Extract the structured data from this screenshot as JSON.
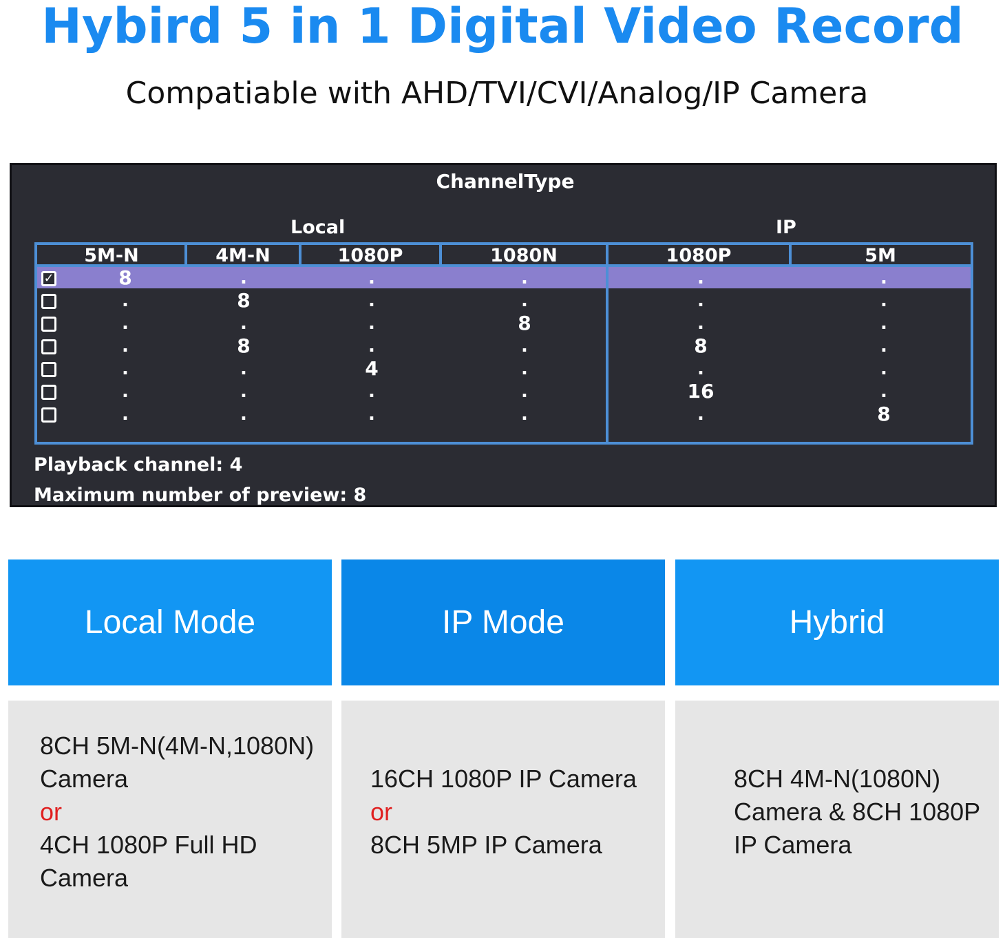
{
  "header": {
    "title": "Hybird 5 in 1 Digital Video Record",
    "subtitle": "Compatiable with AHD/TVI/CVI/Analog/IP Camera"
  },
  "dvr": {
    "window_title": "ChannelType",
    "group_local": "Local",
    "group_ip": "IP",
    "columns": [
      "5M-N",
      "4M-N",
      "1080P",
      "1080N",
      "1080P",
      "5M"
    ],
    "rows": [
      {
        "checked": true,
        "check_mark": "✓",
        "cells": [
          "8",
          ".",
          ".",
          ".",
          ".",
          "."
        ]
      },
      {
        "checked": false,
        "check_mark": "",
        "cells": [
          ".",
          "8",
          ".",
          ".",
          ".",
          "."
        ]
      },
      {
        "checked": false,
        "check_mark": "",
        "cells": [
          ".",
          ".",
          ".",
          "8",
          ".",
          "."
        ]
      },
      {
        "checked": false,
        "check_mark": "",
        "cells": [
          ".",
          "8",
          ".",
          ".",
          "8",
          "."
        ]
      },
      {
        "checked": false,
        "check_mark": "",
        "cells": [
          ".",
          ".",
          "4",
          ".",
          ".",
          "."
        ]
      },
      {
        "checked": false,
        "check_mark": "",
        "cells": [
          ".",
          ".",
          ".",
          ".",
          "16",
          "."
        ]
      },
      {
        "checked": false,
        "check_mark": "",
        "cells": [
          ".",
          ".",
          ".",
          ".",
          ".",
          "8"
        ]
      }
    ],
    "playback": "Playback channel: 4",
    "max_preview": "Maximum number of preview: 8"
  },
  "modes": [
    {
      "title": "Local Mode",
      "color": "#1296f3",
      "lines": [
        "8CH 5M-N(4M-N,1080N)",
        "Camera",
        "or",
        "4CH 1080P Full HD",
        "Camera"
      ]
    },
    {
      "title": "IP Mode",
      "color": "#0a87e8",
      "lines": [
        "16CH 1080P IP Camera",
        "or",
        "8CH 5MP IP Camera"
      ]
    },
    {
      "title": "Hybrid",
      "color": "#1296f3",
      "lines": [
        "8CH 4M-N(1080N)",
        "Camera & 8CH 1080P",
        "IP Camera"
      ]
    }
  ]
}
